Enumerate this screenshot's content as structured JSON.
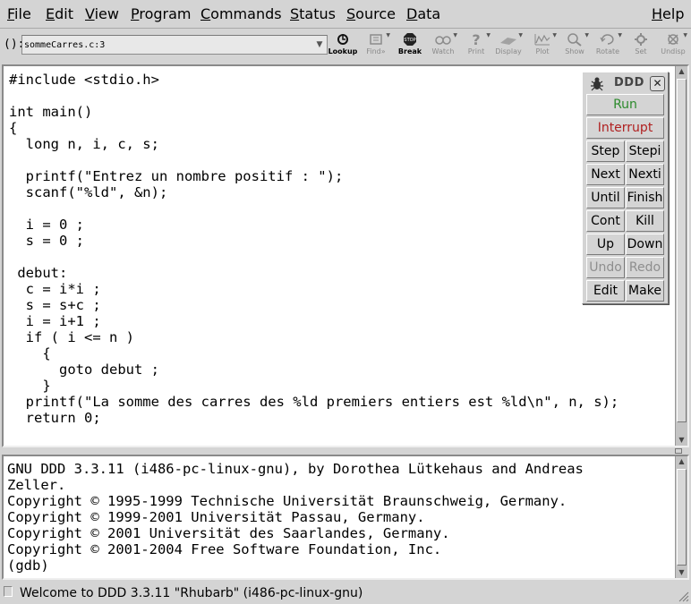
{
  "menubar": {
    "items": [
      {
        "pre": "",
        "mn": "F",
        "post": "ile"
      },
      {
        "pre": "",
        "mn": "E",
        "post": "dit"
      },
      {
        "pre": "",
        "mn": "V",
        "post": "iew"
      },
      {
        "pre": "",
        "mn": "P",
        "post": "rogram"
      },
      {
        "pre": "",
        "mn": "C",
        "post": "ommands"
      },
      {
        "pre": "",
        "mn": "S",
        "post": "tatus"
      },
      {
        "pre": "",
        "mn": "S",
        "post": "ource"
      },
      {
        "pre": "",
        "mn": "D",
        "post": "ata"
      },
      {
        "pre": "",
        "mn": "H",
        "post": "elp"
      }
    ]
  },
  "toolbar": {
    "arg_label": "():",
    "arg_value": "sommeCarres.c:3",
    "buttons": [
      {
        "label": "Lookup",
        "icon": "lookup-icon"
      },
      {
        "label": "Find»",
        "icon": "find-icon"
      },
      {
        "label": "Break",
        "icon": "stop-sign-icon"
      },
      {
        "label": "Watch",
        "icon": "glasses-icon"
      },
      {
        "label": "Print",
        "icon": "question-icon"
      },
      {
        "label": "Display",
        "icon": "display-icon"
      },
      {
        "label": "Plot",
        "icon": "plot-icon"
      },
      {
        "label": "Show",
        "icon": "magnifier-icon"
      },
      {
        "label": "Rotate",
        "icon": "rotate-icon"
      },
      {
        "label": "Set",
        "icon": "set-icon"
      },
      {
        "label": "Undisp",
        "icon": "undisp-icon"
      }
    ]
  },
  "source": {
    "code": "#include <stdio.h>\n\nint main()\n{\n  long n, i, c, s;\n\n  printf(\"Entrez un nombre positif : \");\n  scanf(\"%ld\", &n);\n\n  i = 0 ;\n  s = 0 ;\n\n debut:\n  c = i*i ;\n  s = s+c ;\n  i = i+1 ;\n  if ( i <= n )\n    {\n      goto debut ;\n    }\n  printf(\"La somme des carres des %ld premiers entiers est %ld\\n\", n, s);\n  return 0;"
  },
  "console": {
    "text": "GNU DDD 3.3.11 (i486-pc-linux-gnu), by Dorothea Lütkehaus and Andreas\nZeller.\nCopyright © 1995-1999 Technische Universität Braunschweig, Germany.\nCopyright © 1999-2001 Universität Passau, Germany.\nCopyright © 2001 Universität des Saarlandes, Germany.\nCopyright © 2001-2004 Free Software Foundation, Inc.\n(gdb)"
  },
  "status": {
    "text": "Welcome to DDD 3.3.11 \"Rhubarb\" (i486-pc-linux-gnu)"
  },
  "command_tool": {
    "title": "DDD",
    "close": "✕",
    "run": "Run",
    "interrupt": "Interrupt",
    "rows": [
      [
        "Step",
        "Stepi"
      ],
      [
        "Next",
        "Nexti"
      ],
      [
        "Until",
        "Finish"
      ],
      [
        "Cont",
        "Kill"
      ],
      [
        "Up",
        "Down"
      ],
      [
        "Undo",
        "Redo"
      ],
      [
        "Edit",
        "Make"
      ]
    ]
  }
}
